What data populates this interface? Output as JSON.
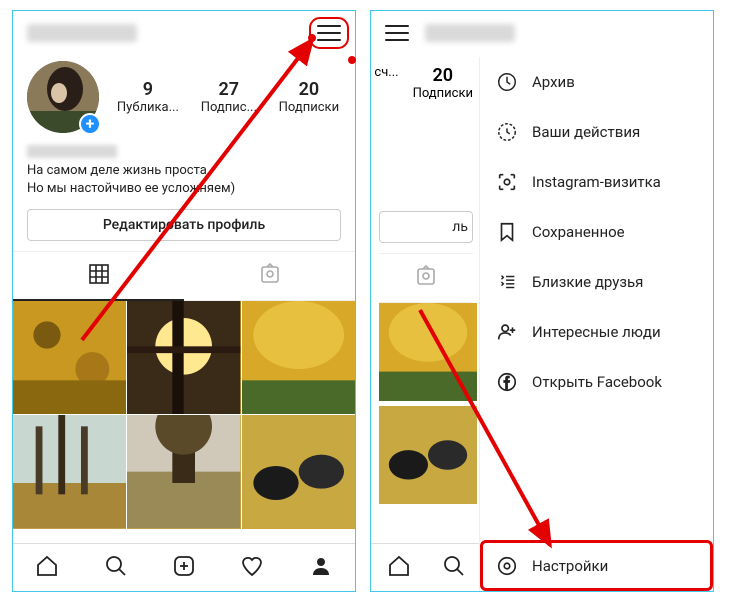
{
  "left": {
    "stats": [
      {
        "num": "9",
        "label": "Публика..."
      },
      {
        "num": "27",
        "label": "Подпис..."
      },
      {
        "num": "20",
        "label": "Подписки"
      }
    ],
    "bio_line1": "На самом деле жизнь проста.",
    "bio_line2": "Но мы настойчиво ее усложняем)",
    "edit_button": "Редактировать профиль"
  },
  "right": {
    "stats_partial": [
      {
        "num": "",
        "label": "сч..."
      },
      {
        "num": "20",
        "label": "Подписки"
      }
    ],
    "edit_partial": "ль",
    "menu": {
      "archive": "Архив",
      "activity": "Ваши действия",
      "nametag": "Instagram-визитка",
      "saved": "Сохраненное",
      "close_friends": "Близкие друзья",
      "discover": "Интересные люди",
      "facebook": "Открыть Facebook",
      "settings": "Настройки"
    }
  }
}
